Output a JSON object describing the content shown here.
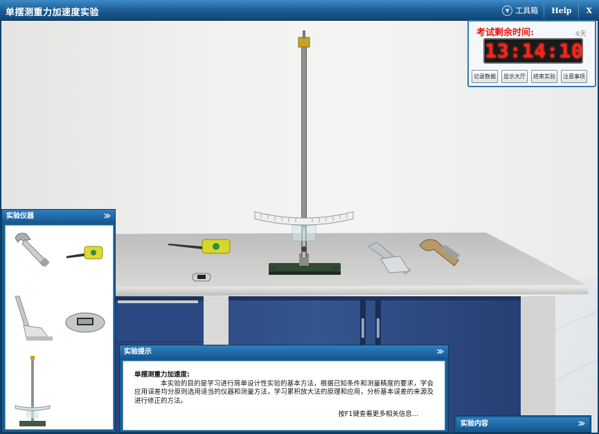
{
  "app": {
    "title": "单摆测重力加速度实验"
  },
  "titlebar": {
    "toolbox_label": "工具箱",
    "help_label": "Help",
    "close_label": "X"
  },
  "timer": {
    "label": "考试剩余时间:",
    "days": "4天",
    "time": "13:14:10",
    "buttons": [
      "记录数据",
      "显示大厅",
      "结束实验",
      "注意事项"
    ]
  },
  "panels": {
    "instruments": {
      "title": "实验仪器",
      "items": [
        {
          "icon": "vernier-caliper-icon"
        },
        {
          "icon": "tape-measure-icon"
        },
        {
          "icon": "caliper-icon"
        },
        {
          "icon": "stopwatch-icon"
        },
        {
          "icon": "pendulum-stand-icon"
        }
      ]
    },
    "hints": {
      "title": "实验提示",
      "heading": "单摆测重力加速度:",
      "text": "本实验的目的是学习进行简单设计性实验的基本方法，根据已知条件和测量精度的要求，学会应用误差均分原则选用适当的仪器和测量方法，学习累积放大法的原理和应用，分析基本误差的来源及进行修正的方法。",
      "more": "按F1键查看更多相关信息..."
    },
    "content": {
      "title": "实验内容"
    }
  },
  "colors": {
    "titlebar": "#1d5e96",
    "timer_digits": "#ff2318",
    "timer_label": "#e8140e",
    "cabinet": "#2f4d86"
  }
}
